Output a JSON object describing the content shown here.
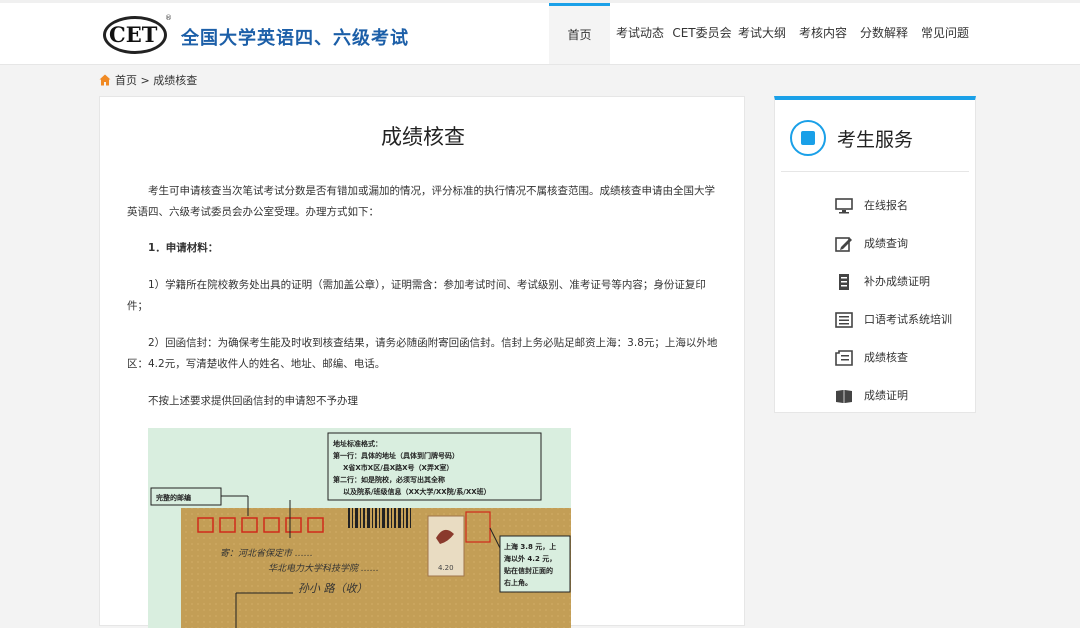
{
  "header": {
    "logo_text": "CET",
    "logo_reg": "®",
    "site_title": "全国大学英语四、六级考试",
    "nav": [
      {
        "label": "首页",
        "active": true
      },
      {
        "label": "考试动态"
      },
      {
        "label": "CET委员会"
      },
      {
        "label": "考试大纲"
      },
      {
        "label": "考核内容"
      },
      {
        "label": "分数解释"
      },
      {
        "label": "常见问题"
      }
    ]
  },
  "breadcrumb": {
    "home": "首页",
    "separator": ">",
    "current": "成绩核查"
  },
  "article": {
    "title": "成绩核查",
    "p1": "考生可申请核查当次笔试考试分数是否有错加或漏加的情况，评分标准的执行情况不属核查范围。成绩核查申请由全国大学英语四、六级考试委员会办公室受理。办理方式如下：",
    "p2_heading": "1．申请材料：",
    "p3": "1）学籍所在院校教务处出具的证明（需加盖公章），证明需含：参加考试时间、考试级别、准考证号等内容；身份证复印件；",
    "p4": "2）回函信封：为确保考生能及时收到核查结果，请务必随函附寄回函信封。信封上务必贴足邮资上海：3.8元；上海以外地区：4.2元，写清楚收件人的姓名、地址、邮编、电话。",
    "p5": "不按上述要求提供回函信封的申请恕不予办理",
    "figure": {
      "label_postcode": "完整的邮编",
      "address_box": [
        "地址标准格式：",
        "第一行：具体的地址（具体到门牌号码）",
        "X省X市X区/县X路X号（X弄X室）",
        "第二行：如是院校，必须写出其全称",
        "以及院系/班级信息（XX大学/XX院/系/XX班）"
      ],
      "stamp_box": [
        "上海 3.8 元，上",
        "海以外 4.2 元，",
        "贴在信封正面的",
        "右上角。"
      ],
      "handwriting_1": "寄：河北省保定市 ……",
      "handwriting_2": "华北电力大学科技学院 ……",
      "handwriting_3": "孙小 路（收）",
      "stamp_value": "4.20"
    }
  },
  "sidebar": {
    "title": "考生服务",
    "items": [
      {
        "label": "在线报名",
        "icon": "monitor-icon"
      },
      {
        "label": "成绩查询",
        "icon": "edit-icon"
      },
      {
        "label": "补办成绩证明",
        "icon": "document-icon"
      },
      {
        "label": "口语考试系统培训",
        "icon": "list-icon"
      },
      {
        "label": "成绩核查",
        "icon": "clipboard-icon"
      },
      {
        "label": "成绩证明",
        "icon": "book-icon"
      }
    ]
  },
  "colors": {
    "accent": "#1aa0e8",
    "title_blue": "#1c5fa8",
    "envelope": "#c8a35c",
    "figure_bg": "#d9eedf",
    "home_orange": "#f08a24"
  }
}
